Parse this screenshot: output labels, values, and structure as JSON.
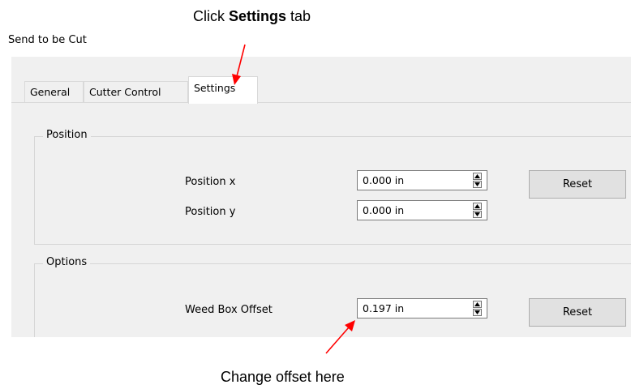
{
  "annotations": {
    "top_callout_prefix": "Click ",
    "top_callout_bold": "Settings",
    "top_callout_suffix": " tab",
    "bottom_callout": "Change offset here",
    "arrow_color": "#ff0000"
  },
  "window": {
    "title": "Send to be Cut"
  },
  "tabs": [
    {
      "label": "General",
      "active": false
    },
    {
      "label": "Cutter Control",
      "active": false
    },
    {
      "label": "Settings",
      "active": true
    }
  ],
  "position_group": {
    "legend": "Position",
    "x_label": "Position x",
    "x_value": "0.000 in",
    "y_label": "Position y",
    "y_value": "0.000 in",
    "reset_label": "Reset"
  },
  "options_group": {
    "legend": "Options",
    "weed_label": "Weed Box Offset",
    "weed_value": "0.197 in",
    "reset_label": "Reset"
  },
  "icons": {
    "spin_up": "triangle-up-icon",
    "spin_down": "triangle-down-icon"
  }
}
